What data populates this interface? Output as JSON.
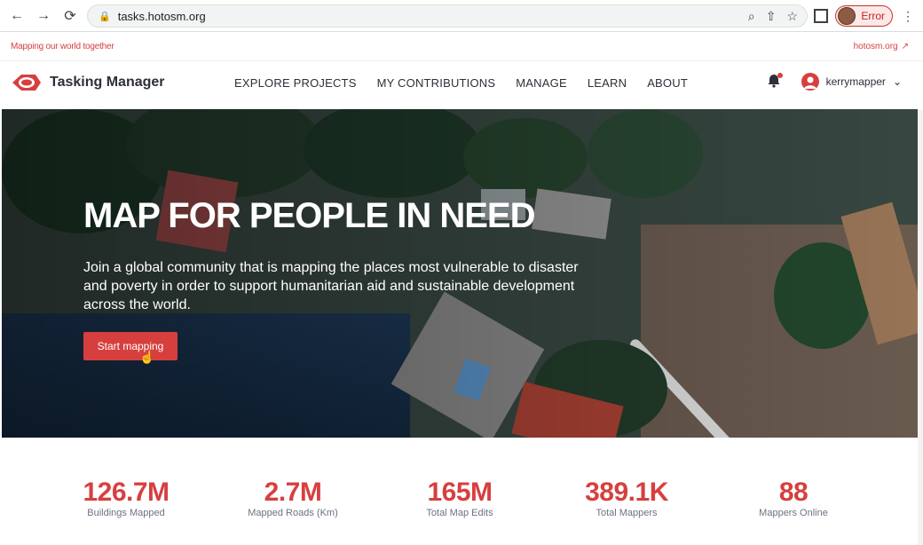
{
  "browser": {
    "url": "tasks.hotosm.org",
    "profile_label": "Error"
  },
  "top_strip": {
    "tagline": "Mapping our world together",
    "external_link": "hotosm.org"
  },
  "header": {
    "app_title": "Tasking Manager",
    "nav": [
      "EXPLORE PROJECTS",
      "MY CONTRIBUTIONS",
      "MANAGE",
      "LEARN",
      "ABOUT"
    ],
    "username": "kerrymapper"
  },
  "hero": {
    "title": "MAP FOR PEOPLE IN NEED",
    "description": "Join a global community that is mapping the places most vulnerable to disaster and poverty in order to support humanitarian aid and sustainable development across the world.",
    "cta": "Start mapping"
  },
  "stats": [
    {
      "value": "126.7M",
      "label": "Buildings Mapped"
    },
    {
      "value": "2.7M",
      "label": "Mapped Roads (Km)"
    },
    {
      "value": "165M",
      "label": "Total Map Edits"
    },
    {
      "value": "389.1K",
      "label": "Total Mappers"
    },
    {
      "value": "88",
      "label": "Mappers Online"
    }
  ],
  "colors": {
    "accent": "#d73f3f",
    "text_dark": "#2c3038",
    "muted": "#6b7280"
  },
  "icons": {
    "back": "arrow-left-icon",
    "forward": "arrow-right-icon",
    "reload": "reload-icon",
    "lock": "lock-icon",
    "zoom": "zoom-icon",
    "share": "share-icon",
    "bookmark": "star-icon",
    "external": "external-link-icon",
    "notifications": "bell-icon",
    "user": "user-icon",
    "chevron": "chevron-down-icon"
  }
}
